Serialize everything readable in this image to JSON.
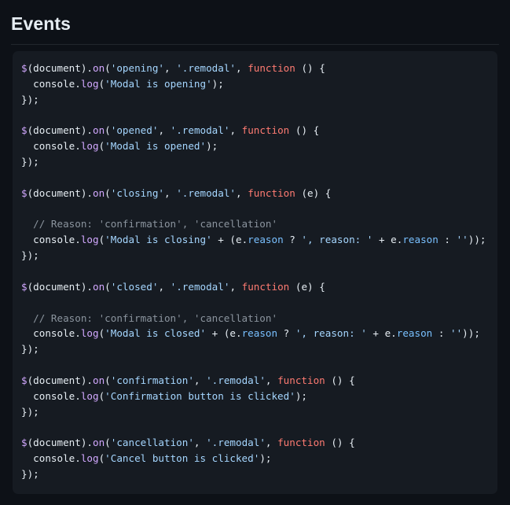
{
  "header": {
    "title": "Events"
  },
  "code_block": {
    "language": "javascript",
    "colors": {
      "page_background": "#0d1117",
      "card_background": "#161b22",
      "default_text": "#e6edf3",
      "variable": "#d2a8ff",
      "function_name": "#d2a8ff",
      "string": "#a5d6ff",
      "keyword": "#ff7b72",
      "property": "#79c0ff",
      "comment": "#8b949e",
      "rule": "#21262d"
    },
    "lines": [
      [
        {
          "t": "$",
          "c": "tok-var"
        },
        {
          "t": "(document).",
          "c": "tok-plain"
        },
        {
          "t": "on",
          "c": "tok-fn"
        },
        {
          "t": "(",
          "c": "tok-plain"
        },
        {
          "t": "'opening'",
          "c": "tok-str"
        },
        {
          "t": ", ",
          "c": "tok-plain"
        },
        {
          "t": "'.remodal'",
          "c": "tok-str"
        },
        {
          "t": ", ",
          "c": "tok-plain"
        },
        {
          "t": "function",
          "c": "tok-kw"
        },
        {
          "t": " () {",
          "c": "tok-plain"
        }
      ],
      [
        {
          "t": "  console.",
          "c": "tok-plain"
        },
        {
          "t": "log",
          "c": "tok-fn"
        },
        {
          "t": "(",
          "c": "tok-plain"
        },
        {
          "t": "'Modal is opening'",
          "c": "tok-str"
        },
        {
          "t": ");",
          "c": "tok-plain"
        }
      ],
      [
        {
          "t": "});",
          "c": "tok-plain"
        }
      ],
      [],
      [
        {
          "t": "$",
          "c": "tok-var"
        },
        {
          "t": "(document).",
          "c": "tok-plain"
        },
        {
          "t": "on",
          "c": "tok-fn"
        },
        {
          "t": "(",
          "c": "tok-plain"
        },
        {
          "t": "'opened'",
          "c": "tok-str"
        },
        {
          "t": ", ",
          "c": "tok-plain"
        },
        {
          "t": "'.remodal'",
          "c": "tok-str"
        },
        {
          "t": ", ",
          "c": "tok-plain"
        },
        {
          "t": "function",
          "c": "tok-kw"
        },
        {
          "t": " () {",
          "c": "tok-plain"
        }
      ],
      [
        {
          "t": "  console.",
          "c": "tok-plain"
        },
        {
          "t": "log",
          "c": "tok-fn"
        },
        {
          "t": "(",
          "c": "tok-plain"
        },
        {
          "t": "'Modal is opened'",
          "c": "tok-str"
        },
        {
          "t": ");",
          "c": "tok-plain"
        }
      ],
      [
        {
          "t": "});",
          "c": "tok-plain"
        }
      ],
      [],
      [
        {
          "t": "$",
          "c": "tok-var"
        },
        {
          "t": "(document).",
          "c": "tok-plain"
        },
        {
          "t": "on",
          "c": "tok-fn"
        },
        {
          "t": "(",
          "c": "tok-plain"
        },
        {
          "t": "'closing'",
          "c": "tok-str"
        },
        {
          "t": ", ",
          "c": "tok-plain"
        },
        {
          "t": "'.remodal'",
          "c": "tok-str"
        },
        {
          "t": ", ",
          "c": "tok-plain"
        },
        {
          "t": "function",
          "c": "tok-kw"
        },
        {
          "t": " (e) {",
          "c": "tok-plain"
        }
      ],
      [],
      [
        {
          "t": "  // Reason: 'confirmation', 'cancellation'",
          "c": "tok-comment"
        }
      ],
      [
        {
          "t": "  console.",
          "c": "tok-plain"
        },
        {
          "t": "log",
          "c": "tok-fn"
        },
        {
          "t": "(",
          "c": "tok-plain"
        },
        {
          "t": "'Modal is closing'",
          "c": "tok-str"
        },
        {
          "t": " + (e.",
          "c": "tok-plain"
        },
        {
          "t": "reason",
          "c": "tok-prop"
        },
        {
          "t": " ? ",
          "c": "tok-plain"
        },
        {
          "t": "', reason: '",
          "c": "tok-str"
        },
        {
          "t": " + e.",
          "c": "tok-plain"
        },
        {
          "t": "reason",
          "c": "tok-prop"
        },
        {
          "t": " : ",
          "c": "tok-plain"
        },
        {
          "t": "''",
          "c": "tok-str"
        },
        {
          "t": "));",
          "c": "tok-plain"
        }
      ],
      [
        {
          "t": "});",
          "c": "tok-plain"
        }
      ],
      [],
      [
        {
          "t": "$",
          "c": "tok-var"
        },
        {
          "t": "(document).",
          "c": "tok-plain"
        },
        {
          "t": "on",
          "c": "tok-fn"
        },
        {
          "t": "(",
          "c": "tok-plain"
        },
        {
          "t": "'closed'",
          "c": "tok-str"
        },
        {
          "t": ", ",
          "c": "tok-plain"
        },
        {
          "t": "'.remodal'",
          "c": "tok-str"
        },
        {
          "t": ", ",
          "c": "tok-plain"
        },
        {
          "t": "function",
          "c": "tok-kw"
        },
        {
          "t": " (e) {",
          "c": "tok-plain"
        }
      ],
      [],
      [
        {
          "t": "  // Reason: 'confirmation', 'cancellation'",
          "c": "tok-comment"
        }
      ],
      [
        {
          "t": "  console.",
          "c": "tok-plain"
        },
        {
          "t": "log",
          "c": "tok-fn"
        },
        {
          "t": "(",
          "c": "tok-plain"
        },
        {
          "t": "'Modal is closed'",
          "c": "tok-str"
        },
        {
          "t": " + (e.",
          "c": "tok-plain"
        },
        {
          "t": "reason",
          "c": "tok-prop"
        },
        {
          "t": " ? ",
          "c": "tok-plain"
        },
        {
          "t": "', reason: '",
          "c": "tok-str"
        },
        {
          "t": " + e.",
          "c": "tok-plain"
        },
        {
          "t": "reason",
          "c": "tok-prop"
        },
        {
          "t": " : ",
          "c": "tok-plain"
        },
        {
          "t": "''",
          "c": "tok-str"
        },
        {
          "t": "));",
          "c": "tok-plain"
        }
      ],
      [
        {
          "t": "});",
          "c": "tok-plain"
        }
      ],
      [],
      [
        {
          "t": "$",
          "c": "tok-var"
        },
        {
          "t": "(document).",
          "c": "tok-plain"
        },
        {
          "t": "on",
          "c": "tok-fn"
        },
        {
          "t": "(",
          "c": "tok-plain"
        },
        {
          "t": "'confirmation'",
          "c": "tok-str"
        },
        {
          "t": ", ",
          "c": "tok-plain"
        },
        {
          "t": "'.remodal'",
          "c": "tok-str"
        },
        {
          "t": ", ",
          "c": "tok-plain"
        },
        {
          "t": "function",
          "c": "tok-kw"
        },
        {
          "t": " () {",
          "c": "tok-plain"
        }
      ],
      [
        {
          "t": "  console.",
          "c": "tok-plain"
        },
        {
          "t": "log",
          "c": "tok-fn"
        },
        {
          "t": "(",
          "c": "tok-plain"
        },
        {
          "t": "'Confirmation button is clicked'",
          "c": "tok-str"
        },
        {
          "t": ");",
          "c": "tok-plain"
        }
      ],
      [
        {
          "t": "});",
          "c": "tok-plain"
        }
      ],
      [],
      [
        {
          "t": "$",
          "c": "tok-var"
        },
        {
          "t": "(document).",
          "c": "tok-plain"
        },
        {
          "t": "on",
          "c": "tok-fn"
        },
        {
          "t": "(",
          "c": "tok-plain"
        },
        {
          "t": "'cancellation'",
          "c": "tok-str"
        },
        {
          "t": ", ",
          "c": "tok-plain"
        },
        {
          "t": "'.remodal'",
          "c": "tok-str"
        },
        {
          "t": ", ",
          "c": "tok-plain"
        },
        {
          "t": "function",
          "c": "tok-kw"
        },
        {
          "t": " () {",
          "c": "tok-plain"
        }
      ],
      [
        {
          "t": "  console.",
          "c": "tok-plain"
        },
        {
          "t": "log",
          "c": "tok-fn"
        },
        {
          "t": "(",
          "c": "tok-plain"
        },
        {
          "t": "'Cancel button is clicked'",
          "c": "tok-str"
        },
        {
          "t": ");",
          "c": "tok-plain"
        }
      ],
      [
        {
          "t": "});",
          "c": "tok-plain"
        }
      ]
    ]
  }
}
